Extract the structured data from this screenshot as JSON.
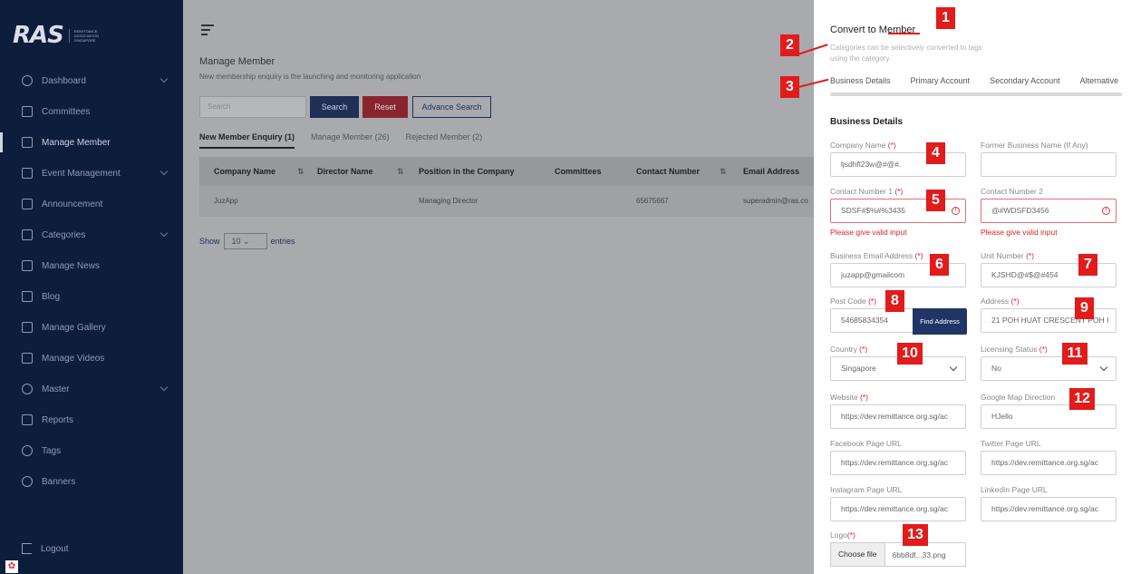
{
  "sidebar": {
    "logo_mark": "RAS",
    "logo_sub": "REMITTANCE ASSOCIATION SINGAPORE",
    "items": [
      {
        "label": "Dashboard",
        "icon": "globe-icon",
        "has_caret": true
      },
      {
        "label": "Committees",
        "icon": "committees-icon",
        "has_caret": false
      },
      {
        "label": "Manage Member",
        "icon": "member-icon",
        "has_caret": false,
        "active": true
      },
      {
        "label": "Event Management",
        "icon": "calendar-icon",
        "has_caret": true
      },
      {
        "label": "Announcement",
        "icon": "megaphone-icon",
        "has_caret": false
      },
      {
        "label": "Categories",
        "icon": "categories-icon",
        "has_caret": true
      },
      {
        "label": "Manage News",
        "icon": "news-icon",
        "has_caret": false
      },
      {
        "label": "Blog",
        "icon": "blog-icon",
        "has_caret": false
      },
      {
        "label": "Manage Gallery",
        "icon": "gallery-icon",
        "has_caret": false
      },
      {
        "label": "Manage Videos",
        "icon": "video-icon",
        "has_caret": false
      },
      {
        "label": "Master",
        "icon": "gear-icon",
        "has_caret": true
      },
      {
        "label": "Reports",
        "icon": "reports-icon",
        "has_caret": false
      },
      {
        "label": "Tags",
        "icon": "tags-icon",
        "has_caret": false
      },
      {
        "label": "Banners",
        "icon": "banners-icon",
        "has_caret": false
      }
    ],
    "logout": "Logout"
  },
  "main": {
    "title": "Manage Member",
    "subtitle": "New membership enquiry is the launching and monitoring application",
    "search_placeholder": "Search",
    "search_button": "Search",
    "reset_button": "Reset",
    "advance_button": "Advance Search",
    "tabs": [
      "New Member Enquiry (1)",
      "Manage Member (26)",
      "Rejected Member (2)"
    ],
    "table": {
      "headers": [
        "Company Name",
        "Director Name",
        "Position in the Company",
        "Committees",
        "Contact Number",
        "Email Address"
      ],
      "rows": [
        [
          "JuzApp",
          "",
          "Managing Director",
          "",
          "65675667",
          "superadmin@ras.co"
        ]
      ]
    },
    "show_label": "Show",
    "show_value": "10",
    "entries_label": "entries"
  },
  "panel": {
    "title": "Convert to Member",
    "description": "Categories can be selectively converted to tags using the category.",
    "tabs": [
      "Business Details",
      "Primary Account",
      "Secondary Account",
      "Alternative"
    ],
    "section_title": "Business Details",
    "fields": {
      "company_name": {
        "label": "Company Name",
        "req": "(*)",
        "value": "ljsdhfl23w@#@#."
      },
      "former_name": {
        "label": "Former Business Name (If Any)",
        "value": ""
      },
      "contact1": {
        "label": "Contact Number 1",
        "req": "(*)",
        "value": "SDSF#$%#%3435",
        "error": "Please give valid input"
      },
      "contact2": {
        "label": "Contact Number 2",
        "value": "@#WDSFD3456",
        "error": "Please give valid input"
      },
      "email": {
        "label": "Business Email Address",
        "req": "(*)",
        "value": "juzapp@gmailcom"
      },
      "unit": {
        "label": "Unit Number",
        "req": "(*)",
        "value": "KJSHD@#$@#454"
      },
      "postcode": {
        "label": "Post Code",
        "req": "(*)",
        "value": "54685834354"
      },
      "find_address": "Find Address",
      "address": {
        "label": "Address",
        "req": "(*)",
        "value": "21 POH HUAT CRESCENT POH I"
      },
      "country": {
        "label": "Country",
        "req": "(*)",
        "value": "Singapore"
      },
      "licensing": {
        "label": "Licensing Status",
        "req": "(*)",
        "value": "No"
      },
      "website": {
        "label": "Website",
        "req": "(*)",
        "value": "https://dev.remittance.org.sg/ac"
      },
      "google_map": {
        "label": "Google Map Direction",
        "value": "HJello"
      },
      "facebook": {
        "label": "Facebook Page URL",
        "value": "https://dev.remittance.org.sg/ac"
      },
      "twitter": {
        "label": "Twitter Page URL",
        "value": "https://dev.remittance.org.sg/ac"
      },
      "instagram": {
        "label": "Instagram Page URL",
        "value": "https://dev.remittance.org.sg/ac"
      },
      "linkedin": {
        "label": "LinkedIn Page URL",
        "value": "https://dev.remittance.org.sg/ac"
      },
      "logo": {
        "label": "Logo",
        "req": "(*)",
        "choose": "Choose file",
        "file_name": "6bb8df...33.png"
      }
    }
  },
  "callouts": [
    "1",
    "2",
    "3",
    "4",
    "5",
    "6",
    "7",
    "8",
    "9",
    "10",
    "11",
    "12",
    "13"
  ],
  "colors": {
    "sidebar": "#0d1d3c",
    "primary": "#1f3563",
    "danger": "#e21b1b",
    "overlay": "#a8aaae"
  }
}
